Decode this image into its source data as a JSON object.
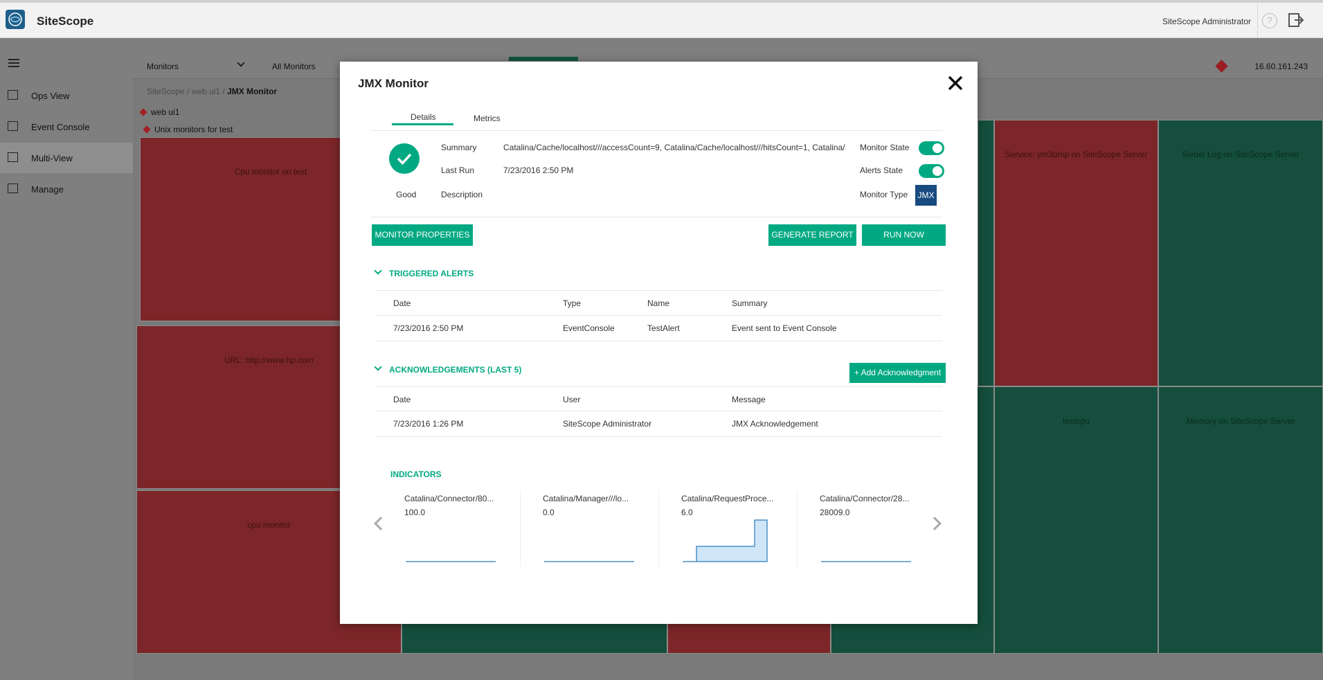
{
  "app": {
    "name": "SiteScope",
    "user": "SiteScope Administrator",
    "help": "?"
  },
  "nav": {
    "items": [
      {
        "label": "Ops View",
        "icon": "ops-view-icon"
      },
      {
        "label": "Event Console",
        "icon": "event-console-icon"
      },
      {
        "label": "Multi-View",
        "icon": "multi-view-icon"
      },
      {
        "label": "Manage",
        "icon": "manage-icon"
      }
    ]
  },
  "toolbar": {
    "dropdown": "Monitors",
    "scope": "All Monitors",
    "ip": "16.60.161.243"
  },
  "breadcrumb": {
    "part1": "SiteScope / web ui1 / ",
    "current": "JMX Monitor"
  },
  "groups": {
    "g1": "web ui1",
    "g2": "Unix monitors for test"
  },
  "tiles": {
    "t1": "Cpu monitor on test",
    "t2": "URL: http://www.hp.com",
    "t3": "cpu monitor",
    "t4": "Service: vm3dmp on SiteScope Server",
    "t5": "Siebel Log on SiteScope Server",
    "t6": "testcpu",
    "t7": "Memory on SiteScope Server"
  },
  "dialog": {
    "title": "JMX Monitor",
    "tabs": {
      "details": "Details",
      "metrics": "Metrics"
    },
    "status": "Good",
    "summary_label": "Summary",
    "summary_value": "Catalina/Cache/localhost///accessCount=9, Catalina/Cache/localhost///hitsCount=1, Catalina/...",
    "lastrun_label": "Last Run",
    "lastrun_value": "7/23/2016 2:50 PM",
    "description_label": "Description",
    "monitor_state_label": "Monitor State",
    "alerts_state_label": "Alerts State",
    "monitor_type_label": "Monitor Type",
    "monitor_type_value": "JMX",
    "buttons": {
      "properties": "MONITOR PROPERTIES",
      "report": "GENERATE REPORT",
      "run": "RUN NOW",
      "ack": "+ Add Acknowledgment"
    },
    "triggered": {
      "title": "TRIGGERED ALERTS",
      "headers": [
        "Date",
        "Type",
        "Name",
        "Summary"
      ],
      "rows": [
        [
          "7/23/2016 2:50 PM",
          "EventConsole",
          "TestAlert",
          "Event sent to Event Console"
        ]
      ]
    },
    "acks": {
      "title": "ACKNOWLEDGEMENTS (LAST 5)",
      "headers": [
        "Date",
        "User",
        "Message"
      ],
      "rows": [
        [
          "7/23/2016 1:26 PM",
          "SiteScope Administrator",
          "JMX Acknowledgement"
        ]
      ]
    },
    "indicators": {
      "title": "INDICATORS",
      "items": [
        {
          "name": "Catalina/Connector/80...",
          "value": "100.0"
        },
        {
          "name": "Catalina/Manager///lo...",
          "value": "0.0"
        },
        {
          "name": "Catalina/RequestProce...",
          "value": "6.0"
        },
        {
          "name": "Catalina/Connector/28...",
          "value": "28009.0"
        }
      ]
    }
  }
}
